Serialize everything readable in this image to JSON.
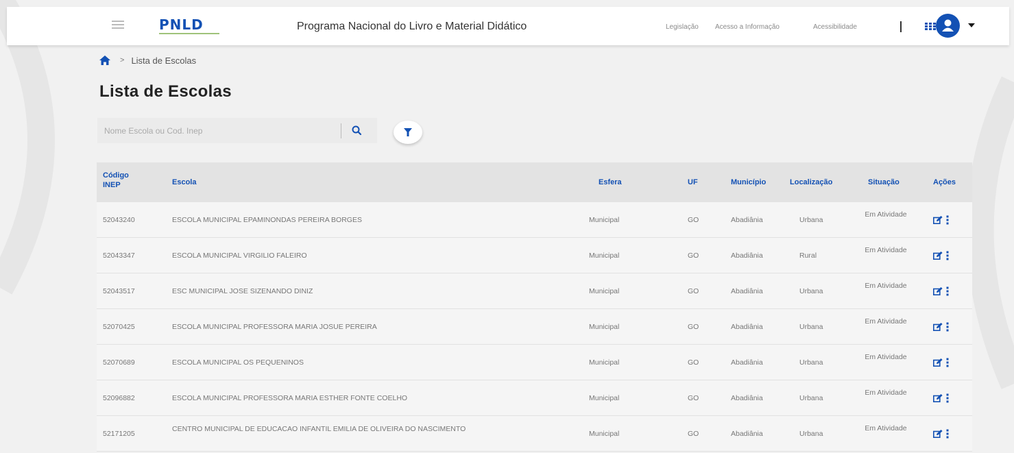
{
  "header": {
    "logo_text": "PNLD",
    "app_title": "Programa Nacional do Livro e Material Didático",
    "links": [
      "Legislação",
      "Acesso a Informação",
      "Acessibilidade"
    ]
  },
  "breadcrumb": {
    "separator": ">",
    "current": "Lista de Escolas"
  },
  "page": {
    "title": "Lista de Escolas"
  },
  "search": {
    "placeholder": "Nome Escola ou Cod. Inep",
    "value": ""
  },
  "table": {
    "columns": {
      "codigo": "Código INEP",
      "escola": "Escola",
      "esfera": "Esfera",
      "uf": "UF",
      "municipio": "Município",
      "localizacao": "Localização",
      "situacao": "Situação",
      "acoes": "Ações"
    },
    "rows": [
      {
        "codigo": "52043240",
        "escola": "ESCOLA MUNICIPAL EPAMINONDAS PEREIRA BORGES",
        "esfera": "Municipal",
        "uf": "GO",
        "municipio": "Abadiânia",
        "localizacao": "Urbana",
        "situacao": "Em Atividade"
      },
      {
        "codigo": "52043347",
        "escola": "ESCOLA MUNICIPAL VIRGILIO FALEIRO",
        "esfera": "Municipal",
        "uf": "GO",
        "municipio": "Abadiânia",
        "localizacao": "Rural",
        "situacao": "Em Atividade"
      },
      {
        "codigo": "52043517",
        "escola": "ESC MUNICIPAL JOSE SIZENANDO DINIZ",
        "esfera": "Municipal",
        "uf": "GO",
        "municipio": "Abadiânia",
        "localizacao": "Urbana",
        "situacao": "Em Atividade"
      },
      {
        "codigo": "52070425",
        "escola": "ESCOLA MUNICIPAL PROFESSORA MARIA JOSUE PEREIRA",
        "esfera": "Municipal",
        "uf": "GO",
        "municipio": "Abadiânia",
        "localizacao": "Urbana",
        "situacao": "Em Atividade"
      },
      {
        "codigo": "52070689",
        "escola": "ESCOLA MUNICIPAL OS PEQUENINOS",
        "esfera": "Municipal",
        "uf": "GO",
        "municipio": "Abadiânia",
        "localizacao": "Urbana",
        "situacao": "Em Atividade"
      },
      {
        "codigo": "52096882",
        "escola": "ESCOLA MUNICIPAL PROFESSORA MARIA ESTHER FONTE COELHO",
        "esfera": "Municipal",
        "uf": "GO",
        "municipio": "Abadiânia",
        "localizacao": "Urbana",
        "situacao": "Em Atividade"
      },
      {
        "codigo": "52171205",
        "escola": "CENTRO MUNICIPAL DE EDUCACAO INFANTIL EMILIA DE OLIVEIRA DO NASCIMENTO",
        "esfera": "Municipal",
        "uf": "GO",
        "municipio": "Abadiânia",
        "localizacao": "Urbana",
        "situacao": "Em Atividade"
      }
    ]
  },
  "icons": {
    "menu": "hamburger-icon",
    "home": "home-icon",
    "search": "search-icon",
    "filter": "filter-icon",
    "apps": "apps-grid-icon",
    "user": "user-icon",
    "edit": "edit-icon",
    "more": "more-vertical-icon"
  },
  "colors": {
    "primary": "#1351b4",
    "header_bg": "#ffffff",
    "page_bg": "#f5f5f5",
    "table_header_bg": "#e3e3e3",
    "logo_accent": "#9fc27a"
  }
}
